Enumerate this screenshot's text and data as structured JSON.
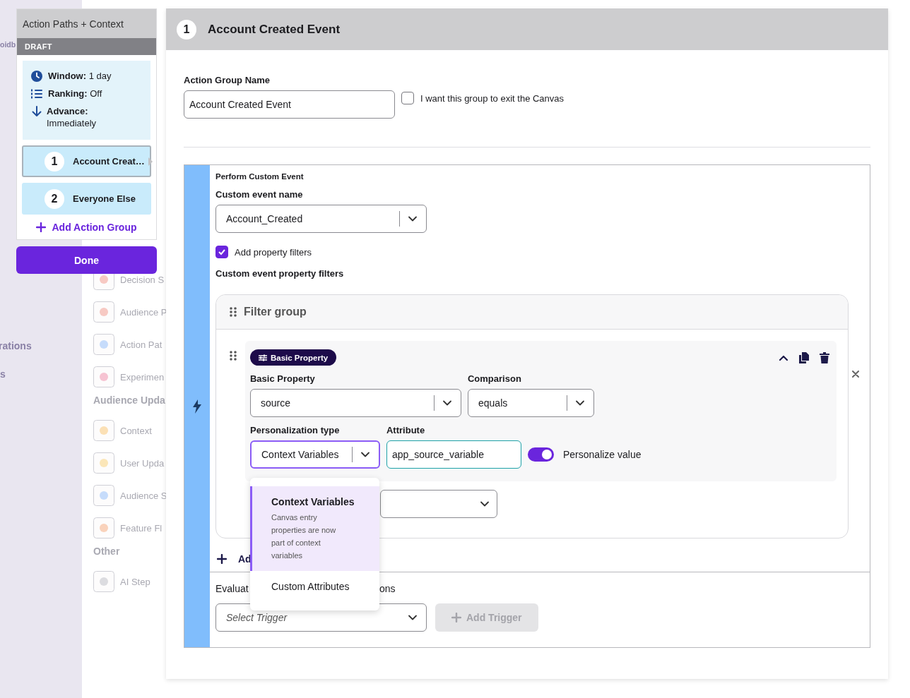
{
  "nav": {
    "items": [
      "oidb",
      "rations",
      "s"
    ]
  },
  "canvas_menu": {
    "sections": [
      {
        "items": [
          {
            "label": "Decision S",
            "color": "#f7c9c3"
          },
          {
            "label": "Audience P",
            "color": "#f7c9c3"
          },
          {
            "label": "Action Pat",
            "color": "#c6dcfb"
          },
          {
            "label": "Experimen",
            "color": "#f6c3d2"
          }
        ]
      },
      {
        "title": "Audience Upda",
        "items": [
          {
            "label": "Context",
            "color": "#fbe0b5"
          },
          {
            "label": "User Upda",
            "color": "#fbe6b8"
          },
          {
            "label": "Audience S",
            "color": "#c6dcfb"
          },
          {
            "label": "Feature Fl",
            "color": "#f9d2bb"
          }
        ]
      },
      {
        "title": "Other",
        "items": [
          {
            "label": "AI Step",
            "color": "#dcdce0"
          }
        ]
      }
    ]
  },
  "journey_panel": {
    "title": "Action Paths + Context",
    "status": "DRAFT",
    "settings": [
      {
        "kind": "window",
        "label": "Window:",
        "value": "1 day"
      },
      {
        "kind": "ranking",
        "label": "Ranking:",
        "value": "Off"
      },
      {
        "kind": "advance",
        "label": "Advance:",
        "value": "Immediately"
      }
    ],
    "groups": [
      {
        "number": "1",
        "name": "Account Creat…",
        "selected": true
      },
      {
        "number": "2",
        "name": "Everyone Else",
        "selected": false
      }
    ],
    "add_group": "Add Action Group",
    "done": "Done"
  },
  "editor": {
    "number": "1",
    "title": "Account Created Event",
    "group_name_label": "Action Group Name",
    "group_name_value": "Account Created Event",
    "exit_canvas": {
      "label": "I want this group to exit the Canvas",
      "checked": false
    },
    "action": {
      "type": "Perform Custom Event",
      "event_name_label": "Custom event name",
      "event_name": "Account_Created",
      "property_filters": {
        "label": "Add property filters",
        "checked": true
      },
      "filters_label": "Custom event property filters",
      "filter_group": {
        "title": "Filter group",
        "filter": {
          "tag": "Basic Property",
          "property_label": "Basic Property",
          "property": "source",
          "comparison_label": "Comparison",
          "comparison": "equals",
          "personalization_label": "Personalization type",
          "personalization": "Context Variables",
          "attribute_label": "Attribute",
          "attribute": "app_source_variable",
          "personalize": {
            "label": "Personalize value",
            "on": true
          }
        }
      },
      "add_filter": "Ad",
      "evaluation": {
        "left": "Evaluat",
        "right": "ons"
      },
      "trigger_placeholder": "Select Trigger",
      "add_trigger": {
        "label": "Add Trigger",
        "disabled": true
      }
    },
    "dropdown": {
      "options": [
        {
          "title": "Context Variables",
          "description": "Canvas entry properties are now part of context variables",
          "selected": true
        },
        {
          "title": "Custom Attributes",
          "selected": false
        }
      ]
    }
  }
}
